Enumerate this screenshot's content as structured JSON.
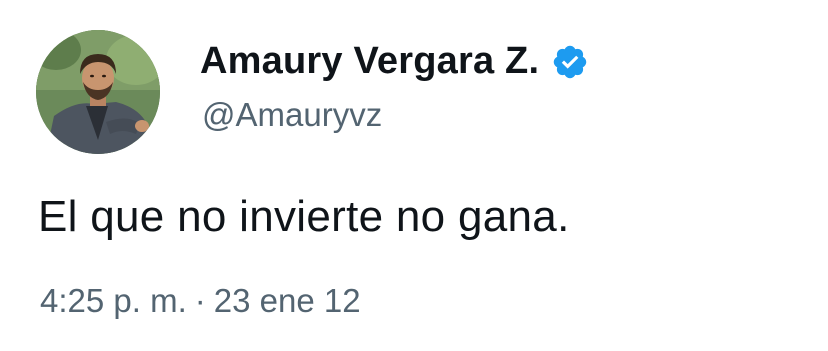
{
  "author": {
    "display_name": "Amaury Vergara Z.",
    "handle": "@Amauryvz",
    "verified_icon": "verified-badge-icon",
    "verified_color": "#1d9bf0"
  },
  "tweet": {
    "text": "El que no invierte no gana.",
    "time": "4:25 p. m.",
    "separator": "·",
    "date": "23 ene 12"
  },
  "colors": {
    "text_primary": "#0f1419",
    "text_secondary": "#536471"
  }
}
